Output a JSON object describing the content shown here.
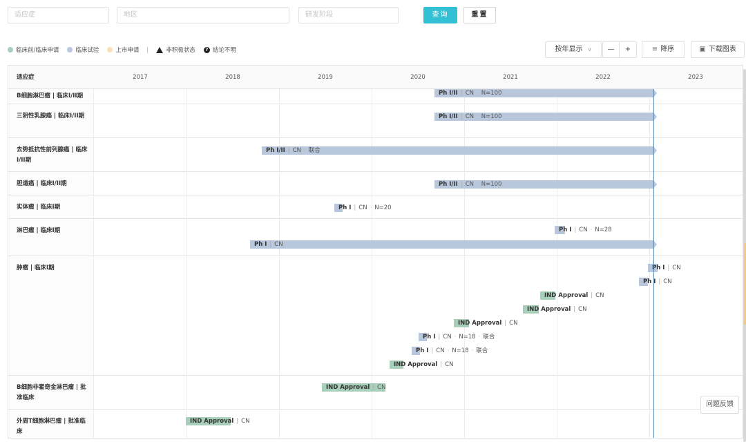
{
  "filters": {
    "indication_placeholder": "适应症",
    "region_placeholder": "地区",
    "stage_placeholder": "研发阶段",
    "query_label": "查询",
    "reset_label": "重置"
  },
  "legend": {
    "preclinical": "临床前/临床申请",
    "clinical": "临床试验",
    "market": "上市申请",
    "inactive": "非积极状态",
    "unclear": "结论不明",
    "colors": {
      "preclinical": "#a8cfb9",
      "clinical": "#b8c7dc",
      "market": "#f8e1b9"
    }
  },
  "controls": {
    "display_mode": "按年显示",
    "minus": "—",
    "plus": "+",
    "sort_label": "降序",
    "download_label": "下载图表"
  },
  "table": {
    "first_col_header": "适应症",
    "years": [
      "2017",
      "2018",
      "2019",
      "2020",
      "2021",
      "2022",
      "2023"
    ]
  },
  "rows": [
    {
      "label": "B细胞淋巴瘤 | 临床I/II期",
      "bars": [
        {
          "type": "ph",
          "arrow": true,
          "phase": "Ph I/II",
          "region": "CN",
          "extra": [
            "N=100"
          ]
        }
      ]
    },
    {
      "label": "三阴性乳腺癌 | 临床I/II期",
      "bars": [
        {
          "type": "ph",
          "arrow": true,
          "phase": "Ph I/II",
          "region": "CN",
          "extra": [
            "N=100"
          ]
        }
      ]
    },
    {
      "label": "去势抵抗性前列腺癌 | 临床I/II期",
      "bars": [
        {
          "type": "ph",
          "arrow": true,
          "phase": "Ph I/II",
          "region": "CN",
          "extra": [
            "联合"
          ]
        }
      ]
    },
    {
      "label": "胆道癌 | 临床I/II期",
      "bars": [
        {
          "type": "ph",
          "arrow": true,
          "phase": "Ph I/II",
          "region": "CN",
          "extra": [
            "N=100"
          ]
        }
      ]
    },
    {
      "label": "实体瘤 | 临床I期",
      "bars": [
        {
          "type": "ph",
          "arrow": false,
          "phase": "Ph I",
          "region": "CN",
          "extra": [
            "N=20"
          ]
        }
      ]
    },
    {
      "label": "淋巴瘤 | 临床I期",
      "bars": [
        {
          "type": "ph",
          "arrow": false,
          "phase": "Ph I",
          "region": "CN",
          "extra": [
            "N=28"
          ]
        },
        {
          "type": "ph",
          "arrow": true,
          "phase": "Ph I",
          "region": "CN",
          "extra": []
        }
      ]
    },
    {
      "label": "肿瘤 | 临床I期",
      "bars": [
        {
          "type": "ph",
          "arrow": false,
          "phase": "Ph I",
          "region": "CN",
          "extra": []
        },
        {
          "type": "ph",
          "arrow": false,
          "phase": "Ph I",
          "region": "CN",
          "extra": []
        },
        {
          "type": "ind",
          "arrow": false,
          "phase": "IND Approval",
          "region": "CN",
          "extra": []
        },
        {
          "type": "ind",
          "arrow": false,
          "phase": "IND Approval",
          "region": "CN",
          "extra": []
        },
        {
          "type": "ind",
          "arrow": false,
          "phase": "IND Approval",
          "region": "CN",
          "extra": []
        },
        {
          "type": "ph",
          "arrow": false,
          "phase": "Ph I",
          "region": "CN",
          "extra": [
            "N=18",
            "联合"
          ]
        },
        {
          "type": "ph",
          "arrow": false,
          "phase": "Ph I",
          "region": "CN",
          "extra": [
            "N=18",
            "联合"
          ]
        },
        {
          "type": "ind",
          "arrow": false,
          "phase": "IND Approval",
          "region": "CN",
          "extra": []
        }
      ]
    },
    {
      "label": "B细胞非霍奇金淋巴瘤 | 批准临床",
      "bars": [
        {
          "type": "ind",
          "arrow": false,
          "phase": "IND Approval",
          "region": "CN",
          "extra": []
        }
      ]
    },
    {
      "label": "外周T细胞淋巴瘤 | 批准临床",
      "bars": [
        {
          "type": "ind",
          "arrow": false,
          "phase": "IND Approval",
          "region": "CN",
          "extra": []
        }
      ]
    }
  ],
  "feedback_label": "问题反馈"
}
